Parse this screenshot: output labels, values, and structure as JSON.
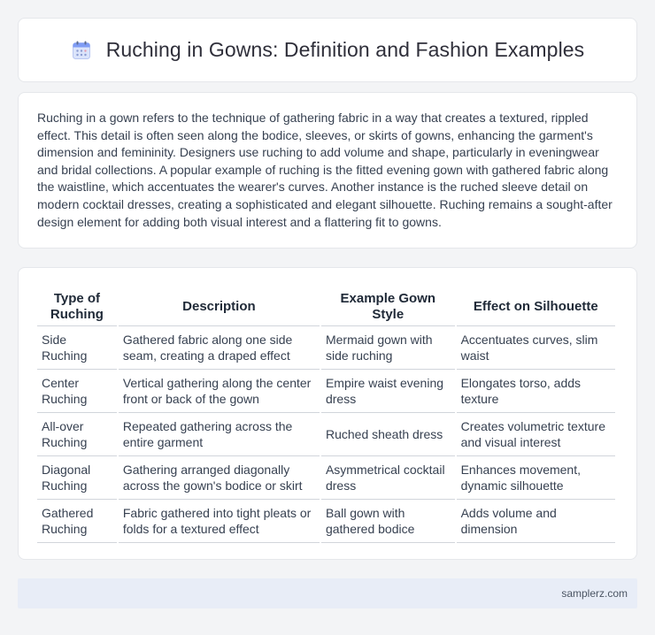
{
  "header": {
    "icon": "calendar-icon",
    "title": "Ruching in Gowns: Definition and Fashion Examples"
  },
  "intro": {
    "text": "Ruching in a gown refers to the technique of gathering fabric in a way that creates a textured, rippled effect. This detail is often seen along the bodice, sleeves, or skirts of gowns, enhancing the garment's dimension and femininity. Designers use ruching to add volume and shape, particularly in eveningwear and bridal collections. A popular example of ruching is the fitted evening gown with gathered fabric along the waistline, which accentuates the wearer's curves. Another instance is the ruched sleeve detail on modern cocktail dresses, creating a sophisticated and elegant silhouette. Ruching remains a sought-after design element for adding both visual interest and a flattering fit to gowns."
  },
  "table": {
    "headers": [
      "Type of Ruching",
      "Description",
      "Example Gown Style",
      "Effect on Silhouette"
    ],
    "rows": [
      [
        "Side Ruching",
        "Gathered fabric along one side seam, creating a draped effect",
        "Mermaid gown with side ruching",
        "Accentuates curves, slim waist"
      ],
      [
        "Center Ruching",
        "Vertical gathering along the center front or back of the gown",
        "Empire waist evening dress",
        "Elongates torso, adds texture"
      ],
      [
        "All-over Ruching",
        "Repeated gathering across the entire garment",
        "Ruched sheath dress",
        "Creates volumetric texture and visual interest"
      ],
      [
        "Diagonal Ruching",
        "Gathering arranged diagonally across the gown's bodice or skirt",
        "Asymmetrical cocktail dress",
        "Enhances movement, dynamic silhouette"
      ],
      [
        "Gathered Ruching",
        "Fabric gathered into tight pleats or folds for a textured effect",
        "Ball gown with gathered bodice",
        "Adds volume and dimension"
      ]
    ]
  },
  "footer": {
    "text": "samplerz.com"
  }
}
